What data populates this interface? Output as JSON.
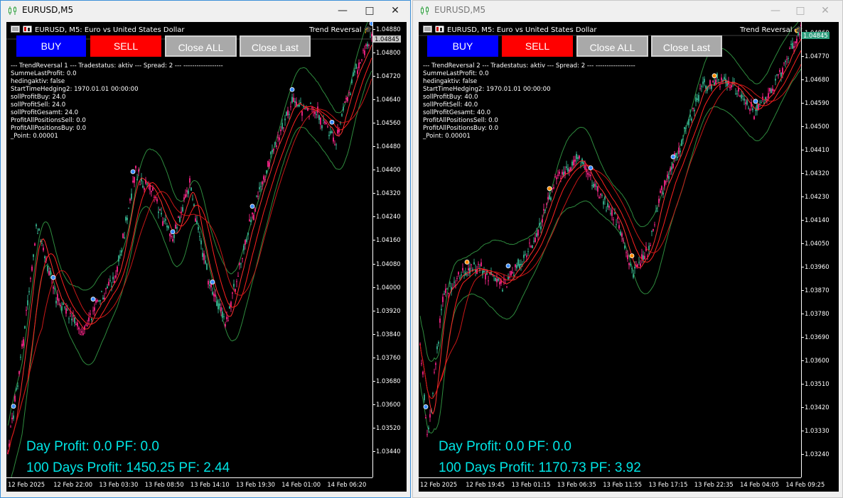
{
  "windows": [
    {
      "title": "EURUSD,M5",
      "symbol_line": "EURUSD, M5:  Euro vs United States Dollar",
      "indicator_label": "Trend Reversal",
      "buttons": {
        "buy": "BUY",
        "sell": "SELL",
        "close_all": "Close ALL",
        "close_last": "Close Last"
      },
      "info_lines": [
        "--- TrendReversal 1 --- Tradestatus: aktiv --- Spread: 2 --- ------------------",
        "SummeLastProfit: 0.0",
        "hedingaktiv: false",
        "StartTimeHedging2: 1970.01.01 00:00:00",
        "sollProfitBuy: 24.0",
        "sollProfitSell: 24.0",
        "sollProfitGesamt: 24.0",
        "ProfitAllPositionsSell: 0.0",
        "ProfitAllPositionsBuy: 0.0",
        "_Point: 0.00001"
      ],
      "day_profit": "Day Profit: 0.0 PF: 0.0",
      "days100_profit": "100 Days Profit: 1450.25 PF: 2.44",
      "current_price": "1.04845",
      "price_axis": [
        "1.04880",
        "1.04800",
        "1.04720",
        "1.04640",
        "1.04560",
        "1.04480",
        "1.04400",
        "1.04320",
        "1.04240",
        "1.04160",
        "1.04080",
        "1.04000",
        "1.03920",
        "1.03840",
        "1.03760",
        "1.03680",
        "1.03600",
        "1.03520",
        "1.03440"
      ],
      "time_axis": [
        "12 Feb 2025",
        "12 Feb 22:00",
        "13 Feb 03:30",
        "13 Feb 08:50",
        "13 Feb 14:10",
        "13 Feb 19:30",
        "14 Feb 01:00",
        "14 Feb 06:20"
      ]
    },
    {
      "title": "EURUSD,M5",
      "symbol_line": "EURUSD, M5:  Euro vs United States Dollar",
      "indicator_label": "Trend Reversal",
      "buttons": {
        "buy": "BUY",
        "sell": "SELL",
        "close_all": "Close ALL",
        "close_last": "Close Last"
      },
      "info_lines": [
        "--- TrendReversal 2 --- Tradestatus: aktiv --- Spread: 2 --- ------------------",
        "SummeLastProfit: 0.0",
        "hedingaktiv: false",
        "StartTimeHedging2: 1970.01.01 00:00:00",
        "sollProfitBuy: 40.0",
        "sollProfitSell: 40.0",
        "sollProfitGesamt: 40.0",
        "ProfitAllPositionsSell: 0.0",
        "ProfitAllPositionsBuy: 0.0",
        "_Point: 0.00001"
      ],
      "day_profit": "Day Profit: 0.0 PF: 0.0",
      "days100_profit": "100 Days Profit: 1170.73 PF: 3.92",
      "current_price": "1.04845",
      "price_axis": [
        "1.04860",
        "1.04770",
        "1.04680",
        "1.04590",
        "1.04500",
        "1.04410",
        "1.04320",
        "1.04230",
        "1.04140",
        "1.04050",
        "1.03960",
        "1.03870",
        "1.03780",
        "1.03690",
        "1.03600",
        "1.03510",
        "1.03420",
        "1.03330",
        "1.03240"
      ],
      "time_axis": [
        "12 Feb 2025",
        "12 Feb 19:45",
        "13 Feb 01:15",
        "13 Feb 06:35",
        "13 Feb 11:55",
        "13 Feb 17:15",
        "13 Feb 22:35",
        "14 Feb 04:05",
        "14 Feb 09:25"
      ]
    }
  ],
  "colors": {
    "buy_button": "#0000ff",
    "sell_button": "#ff0000",
    "grey_button": "#a9a9a9",
    "profit_text": "#00e5e5",
    "envelope": "#2e8b3e",
    "ma": "#ff2020",
    "bull_candle": "#2fa080",
    "bear_candle": "#e0207a"
  },
  "icons": {
    "window_icon": "candlestick-chart-icon",
    "minimize": "minimize-icon",
    "maximize": "maximize-icon",
    "close": "close-icon"
  }
}
